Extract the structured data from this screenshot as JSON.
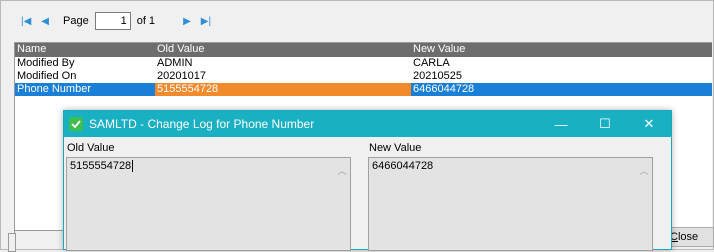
{
  "pager": {
    "first_icon": "first-page-icon",
    "prev_icon": "previous-page-icon",
    "page_label": "Page",
    "page_value": "1",
    "of_label": "of 1",
    "next_icon": "next-page-icon",
    "last_icon": "last-page-icon"
  },
  "grid": {
    "columns": [
      "Name",
      "Old Value",
      "New Value"
    ],
    "rows": [
      {
        "name": "Modified By",
        "old": "ADMIN",
        "new": "CARLA"
      },
      {
        "name": "Modified On",
        "old": "20201017",
        "new": "20210525"
      },
      {
        "name": "Phone Number",
        "old": "5155554728",
        "new": "6466044728"
      }
    ],
    "selected_row_color": "#1a7fd6",
    "highlight_cell_color": "#f08a2c"
  },
  "close_button": {
    "label_underlined": "C",
    "label_rest": "lose"
  },
  "dialog": {
    "title": "SAMLTD - Change Log for Phone Number",
    "title_bar_color": "#1ab0c3",
    "minimize": "—",
    "maximize": "☐",
    "close": "✕",
    "old_label": "Old Value",
    "old_value": "5155554728",
    "new_label": "New Value",
    "new_value": "6466044728"
  }
}
